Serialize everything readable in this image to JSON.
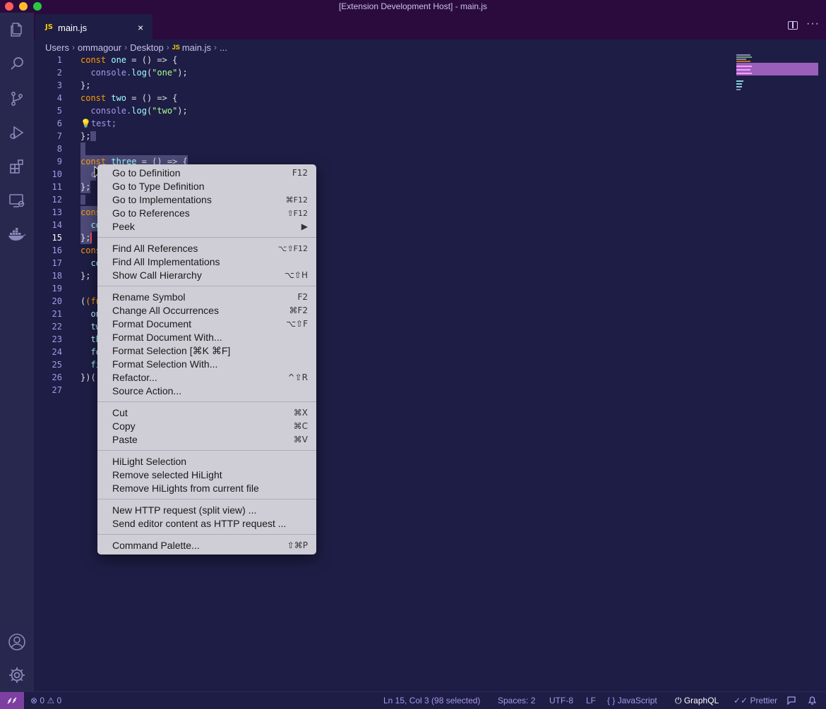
{
  "window": {
    "title": "[Extension Development Host] - main.js"
  },
  "tab": {
    "lang_badge": "JS",
    "label": "main.js",
    "close_glyph": "×"
  },
  "breadcrumb": {
    "parts": [
      "Users",
      "ommagour",
      "Desktop"
    ],
    "file_badge": "JS",
    "file": "main.js",
    "tail": "..."
  },
  "editor": {
    "current_line": 15,
    "lines": [
      {
        "n": "1"
      },
      {
        "n": "2"
      },
      {
        "n": "3"
      },
      {
        "n": "4"
      },
      {
        "n": "5"
      },
      {
        "n": "6"
      },
      {
        "n": "7"
      },
      {
        "n": "8"
      },
      {
        "n": "9"
      },
      {
        "n": "10"
      },
      {
        "n": "11"
      },
      {
        "n": "12"
      },
      {
        "n": "13"
      },
      {
        "n": "14"
      },
      {
        "n": "15"
      },
      {
        "n": "16"
      },
      {
        "n": "17"
      },
      {
        "n": "18"
      },
      {
        "n": "19"
      },
      {
        "n": "20"
      },
      {
        "n": "21"
      },
      {
        "n": "22"
      },
      {
        "n": "23"
      },
      {
        "n": "24"
      },
      {
        "n": "25"
      },
      {
        "n": "26"
      },
      {
        "n": "27"
      }
    ],
    "code": {
      "l1_kw": "const",
      "l1_id": "one",
      "l1_rest": " = () => {",
      "l2_a": "console.",
      "l2_fn": "log",
      "l2_str": "\"one\"",
      "l2_end": ");",
      "l3": "};",
      "l4_kw": "const",
      "l4_id": "two",
      "l4_rest": " = () => {",
      "l5_a": "console.",
      "l5_fn": "log",
      "l5_str": "\"two\"",
      "l5_end": ");",
      "l6": "test;",
      "l7": "};",
      "l9_kw": "const",
      "l9_id": "three",
      "l9_rest": " = () => {",
      "l10": "c",
      "l11": "};",
      "l13": "cons",
      "l14": "co",
      "l15": "};",
      "l16": "cons",
      "l17": "co",
      "l18": "};",
      "l20": "(fun",
      "l21": "on",
      "l22": "tw",
      "l23": "th",
      "l24": "fo",
      "l25": "fi",
      "l26": "})("
    }
  },
  "context_menu": {
    "groups": [
      [
        {
          "label": "Go to Definition",
          "key": "F12"
        },
        {
          "label": "Go to Type Definition",
          "key": ""
        },
        {
          "label": "Go to Implementations",
          "key": "⌘F12"
        },
        {
          "label": "Go to References",
          "key": "⇧F12"
        },
        {
          "label": "Peek",
          "key": "▶"
        }
      ],
      [
        {
          "label": "Find All References",
          "key": "⌥⇧F12"
        },
        {
          "label": "Find All Implementations",
          "key": ""
        },
        {
          "label": "Show Call Hierarchy",
          "key": "⌥⇧H"
        }
      ],
      [
        {
          "label": "Rename Symbol",
          "key": "F2"
        },
        {
          "label": "Change All Occurrences",
          "key": "⌘F2"
        },
        {
          "label": "Format Document",
          "key": "⌥⇧F"
        },
        {
          "label": "Format Document With...",
          "key": ""
        },
        {
          "label": "Format Selection [⌘K ⌘F]",
          "key": ""
        },
        {
          "label": "Format Selection With...",
          "key": ""
        },
        {
          "label": "Refactor...",
          "key": "^⇧R"
        },
        {
          "label": "Source Action...",
          "key": ""
        }
      ],
      [
        {
          "label": "Cut",
          "key": "⌘X"
        },
        {
          "label": "Copy",
          "key": "⌘C"
        },
        {
          "label": "Paste",
          "key": "⌘V"
        }
      ],
      [
        {
          "label": "HiLight Selection",
          "key": ""
        },
        {
          "label": "Remove selected HiLight",
          "key": ""
        },
        {
          "label": "Remove HiLights from current file",
          "key": ""
        }
      ],
      [
        {
          "label": "New HTTP request (split view) ...",
          "key": ""
        },
        {
          "label": "Send editor content as HTTP request ...",
          "key": ""
        }
      ],
      [
        {
          "label": "Command Palette...",
          "key": "⇧⌘P"
        }
      ]
    ]
  },
  "statusbar": {
    "errors": "0",
    "warnings": "0",
    "position": "Ln 15, Col 3 (98 selected)",
    "spaces": "Spaces: 2",
    "encoding": "UTF-8",
    "eol": "LF",
    "language_glyph": "{ }",
    "language": "JavaScript",
    "graphql": "GraphQL",
    "prettier": "Prettier"
  },
  "colors": {
    "background": "#1e1d45",
    "titlebar": "#2b0b3e",
    "remote_indicator": "#7e3fa3",
    "keyword": "#ff9d00",
    "function": "#9effff",
    "string": "#a5ff90",
    "menu_bg": "#cfcdd6"
  },
  "icons": {
    "activity_bar": [
      "explorer-icon",
      "search-icon",
      "source-control-icon",
      "run-debug-icon",
      "extensions-icon",
      "remote-explorer-icon",
      "docker-icon",
      "account-icon",
      "settings-gear-icon"
    ]
  }
}
